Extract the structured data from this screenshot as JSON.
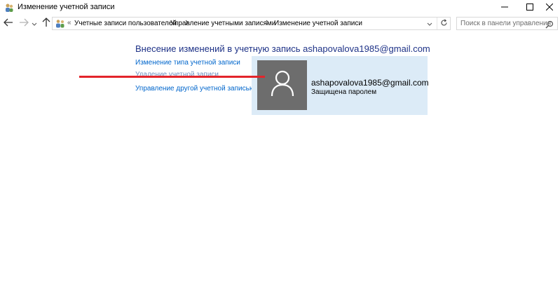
{
  "window": {
    "title": "Изменение учетной записи",
    "controls": [
      "minimize-icon",
      "maximize-icon",
      "close-icon"
    ]
  },
  "navigation": {
    "icons": [
      "back-arrow-icon",
      "forward-arrow-icon",
      "chevron-down-icon",
      "up-arrow-icon"
    ],
    "address_prefix": "«",
    "breadcrumbs": [
      "Учетные записи пользователей",
      "Управление учетными записями",
      "Изменение учетной записи"
    ],
    "search_placeholder": "Поиск в панели управления"
  },
  "main": {
    "heading": "Внесение изменений в учетную запись ashapovalova1985@gmail.com",
    "tasks": [
      "Изменение типа учетной записи",
      "Удаление учетной записи",
      "Управление другой учетной записью"
    ]
  },
  "account": {
    "email": "ashapovalova1985@gmail.com",
    "status": "Защищена паролем",
    "avatar_icon": "user-icon"
  },
  "colors": {
    "link": "#0066cc",
    "heading": "#1e3287",
    "panel_background": "#dcebf7",
    "avatar_background": "#6d6d6d",
    "annotation_line": "#e3242b"
  }
}
